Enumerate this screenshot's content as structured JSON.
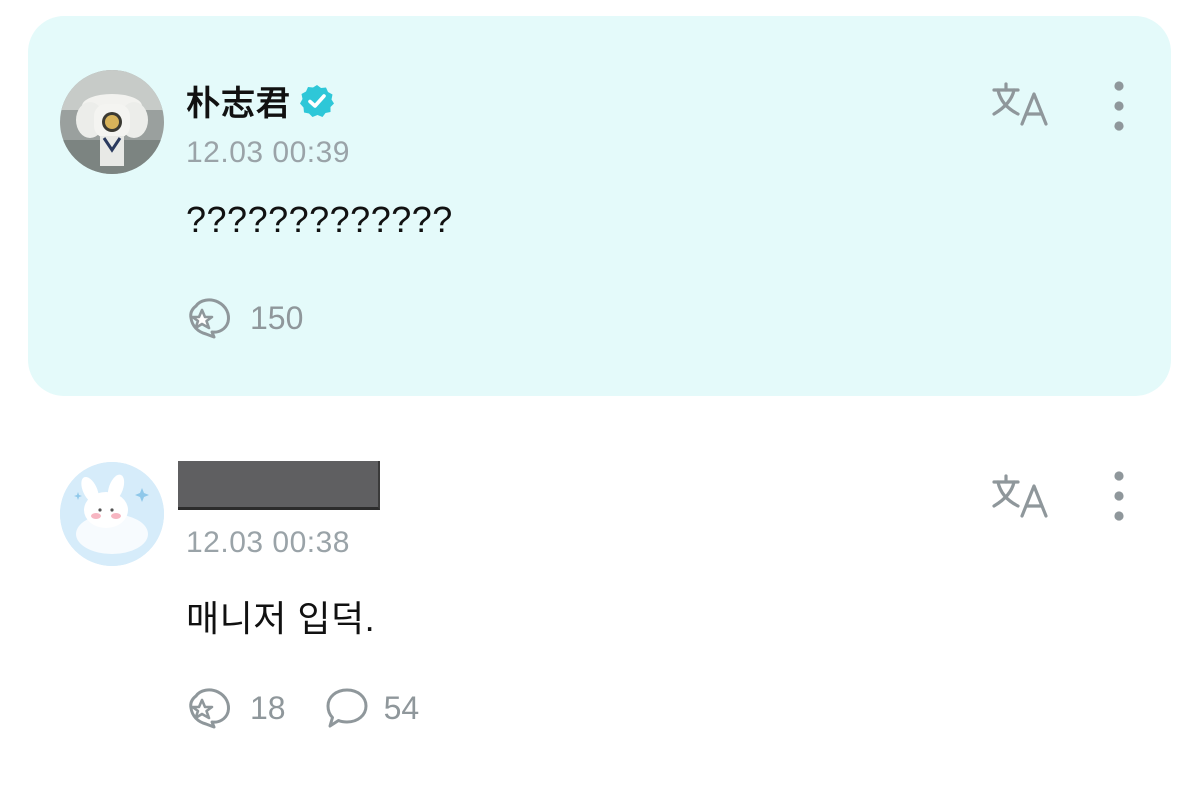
{
  "colors": {
    "highlight_background": "#e4fafa",
    "verified_badge": "#2ec7d8",
    "icon_gray": "#8f979b",
    "timestamp_gray": "#9aa3a8"
  },
  "comments": [
    {
      "author": "朴志君",
      "verified": true,
      "timestamp": "12.03 00:39",
      "text": "?????????????",
      "likes": "150",
      "highlighted": true,
      "icons": [
        "avatar",
        "verified-badge-icon",
        "translate-icon",
        "more-options-icon",
        "like-icon"
      ]
    },
    {
      "author_redacted": true,
      "timestamp": "12.03 00:38",
      "text": "매니저 입덕.",
      "likes": "18",
      "replies": "54",
      "highlighted": false,
      "icons": [
        "avatar",
        "translate-icon",
        "more-options-icon",
        "like-icon",
        "reply-icon"
      ]
    }
  ]
}
